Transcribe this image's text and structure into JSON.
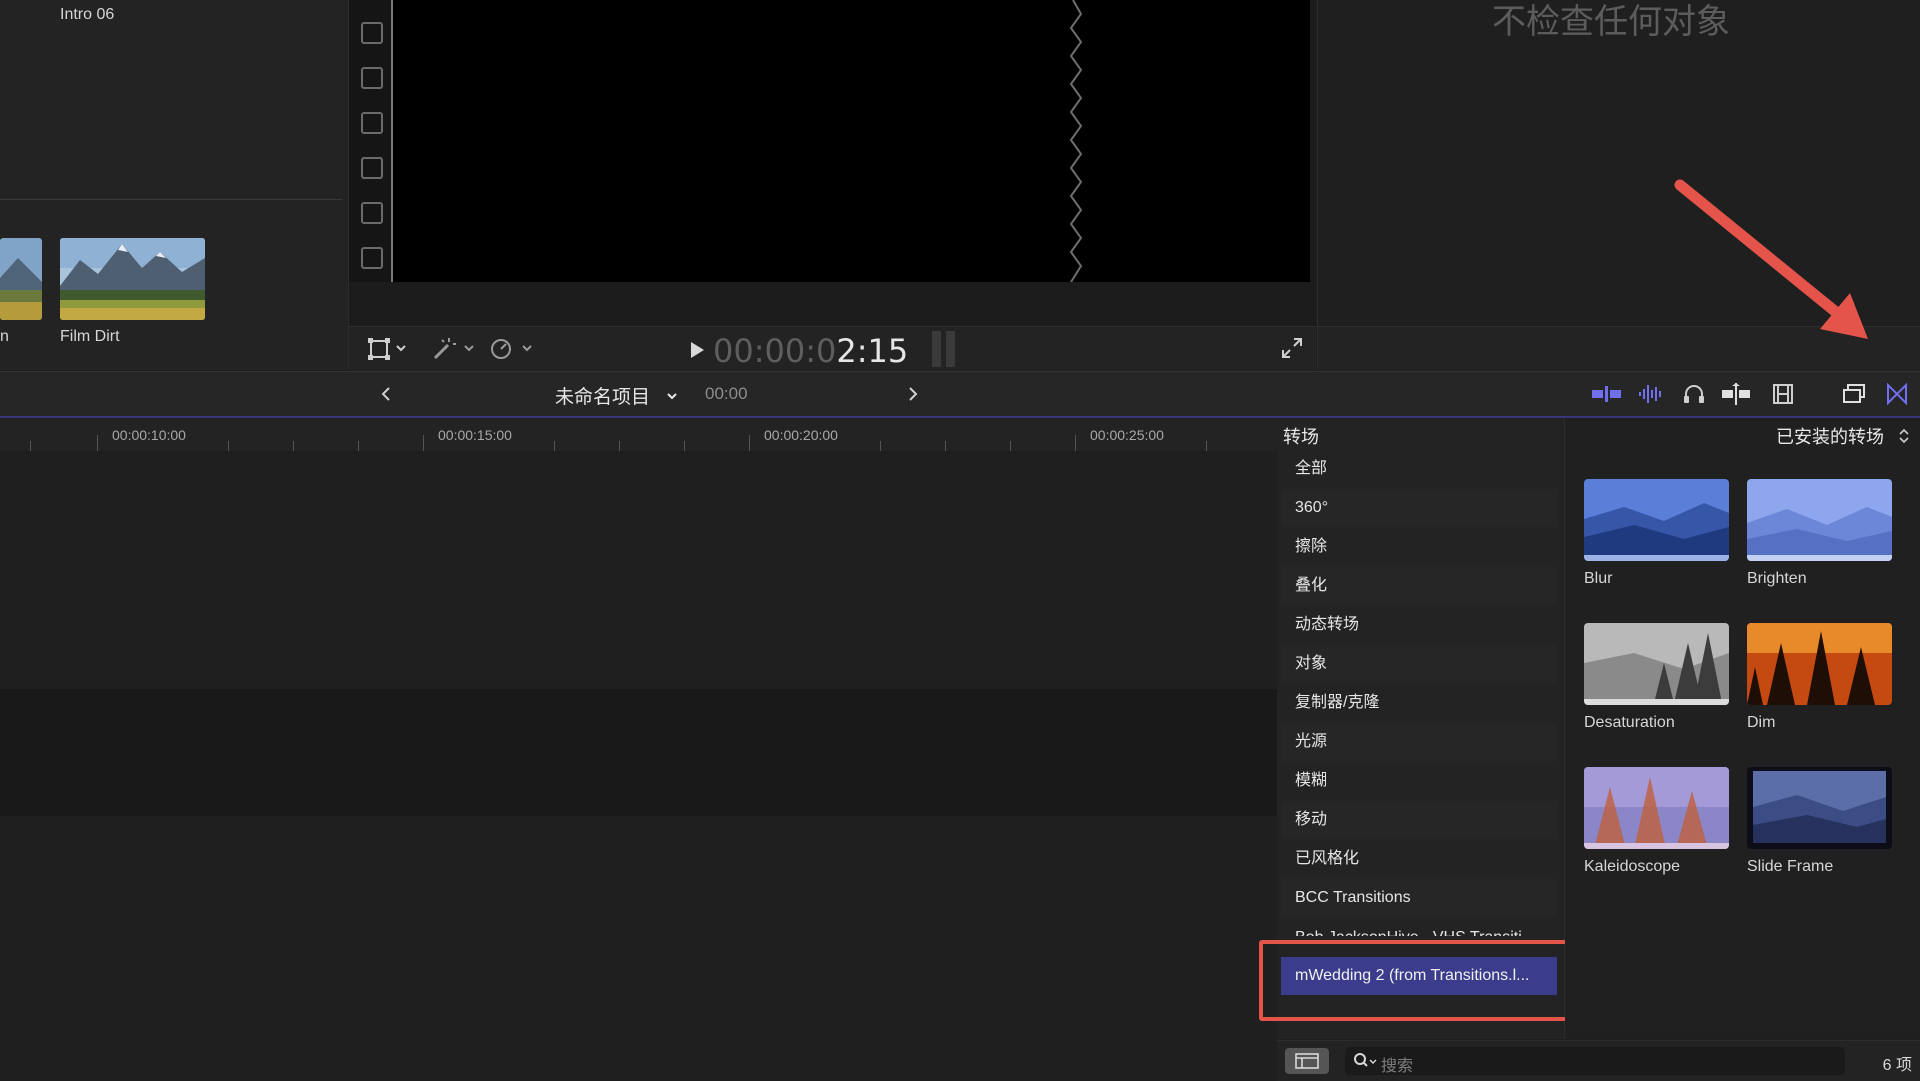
{
  "browser": {
    "top_clip_label": "Intro 06",
    "clips": [
      {
        "label": "n"
      },
      {
        "label": "Film Dirt"
      }
    ]
  },
  "viewer": {
    "timecode_dim": "00:00:0",
    "timecode_bright": "2:15"
  },
  "inspector": {
    "empty_text": "不检查任何对象"
  },
  "timeline": {
    "project_name": "未命名项目",
    "project_time": "00:00",
    "ruler_labels": [
      "00:00:10:00",
      "00:00:15:00",
      "00:00:20:00",
      "00:00:25:00"
    ]
  },
  "transitions": {
    "header": "转场",
    "installed_label": "已安装的转场",
    "categories": [
      "全部",
      "360°",
      "擦除",
      "叠化",
      "动态转场",
      "对象",
      "复制器/克隆",
      "光源",
      "模糊",
      "移动",
      "已风格化",
      "BCC Transitions",
      "Bob JacksonHive - VHS Transiti...",
      "mWedding 2 (from Transitions.l..."
    ],
    "selected_index": 13,
    "items": [
      {
        "name": "Blur"
      },
      {
        "name": "Brighten"
      },
      {
        "name": "Desaturation"
      },
      {
        "name": "Dim"
      },
      {
        "name": "Kaleidoscope"
      },
      {
        "name": "Slide Frame"
      }
    ],
    "search_placeholder": "搜索",
    "item_count": "6 项"
  },
  "colors": {
    "accent": "#3b3d8c",
    "highlight_box": "#e4544b",
    "arrow": "#e4544b",
    "toolbar_active_icon": "#6f6ff0"
  }
}
